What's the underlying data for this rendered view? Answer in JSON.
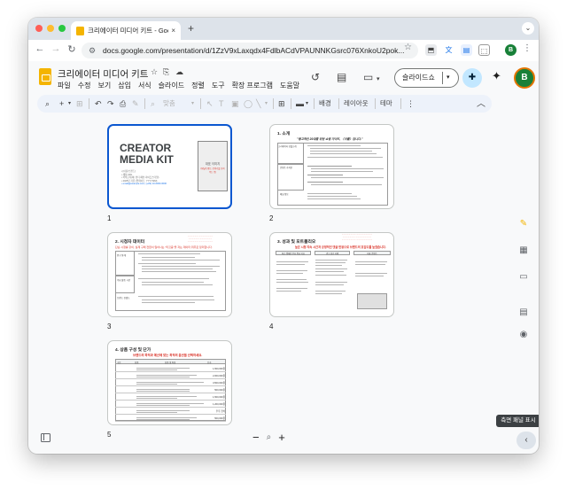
{
  "browser": {
    "tab_title": "크리에이터 미디어 키트 - Google 프레젠테이션",
    "tab_close": "×",
    "new_tab": "+",
    "url": "docs.google.com/presentation/d/1ZzV9xLaxqdx4FdlbACdVPAUNNKGsrc076XnkoU2pok...",
    "profile_initial": "B",
    "traffic_lights": [
      "#ff5f57",
      "#febc2e",
      "#28c840"
    ]
  },
  "app": {
    "doc_title": "크리에이터 미디어 키트",
    "menus": [
      "파일",
      "수정",
      "보기",
      "삽입",
      "서식",
      "슬라이드",
      "정렬",
      "도구",
      "확장 프로그램",
      "도움말"
    ],
    "slideshow_label": "슬라이드쇼",
    "account_initial": "B",
    "accent": "#0b57d0"
  },
  "toolbar": {
    "zoom_value": "맞춤",
    "background_label": "배경",
    "layout_label": "레이아웃",
    "theme_label": "테마"
  },
  "slides": [
    {
      "number": "1",
      "title_line1": "CREATOR",
      "title_line2": "MEDIA KIT",
      "bullets": [
        "• [이름/브랜드]",
        "• 채널 URL",
        "• 카테고리(예: 뷰티·패션·라이프스타일)",
        "• 2025년 기준 (업데이트: YYYY.MM)",
        "• email@example.com | (+82) 10-0000-0000"
      ],
      "image_placeholder": "대표 이미지",
      "image_note": "(채널/브랜드 분위기를 보여주는 컷)"
    },
    {
      "number": "2",
      "heading": "1. 소개",
      "tagline": "\"광고적인 20대를 위한 쇼핑 가이드, 〈이름〉입니다.\"",
      "rows": [
        "크리에이터 한줄소개",
        "콘텐츠 가치관",
        "채널 정보"
      ]
    },
    {
      "number": "3",
      "heading": "2. 시청자 데이터",
      "intro": "단순 시청률 같이, 실제 구매 전환이 일어나는 \"타깃층\"을 자는 데이터 위주로 정리합니다.",
      "rows": [
        "인구 통계",
        "주요 활동 시간",
        "브랜드 친밀도"
      ]
    },
    {
      "number": "4",
      "heading": "3. 성과 및 포트폴리오",
      "intro": "높은 시청 지속 시간과 긍정적인 댓글 반응으로 브랜드의 호감도를 높였습니다.",
      "columns": [
        "최근 캠페인 주요 평균 지표",
        "광고 성공 사례",
        "대표 콘텐츠"
      ]
    },
    {
      "number": "5",
      "heading": "4. 상품 구성 및 단가",
      "intro": "브랜드의 목적과 예산에 맞는 최적의 옵션을 선택하세요.",
      "columns": [
        "구분",
        "상품",
        "상품 및 특징",
        "단가"
      ],
      "prices": [
        "1,500,000원",
        "2,000,000원",
        "3,500,000원",
        "500,000원",
        "1,500,000원",
        "1,200,000원",
        "추후 협의",
        "500,000원"
      ]
    }
  ],
  "side_panel_tooltip": "측면 패널 표시"
}
